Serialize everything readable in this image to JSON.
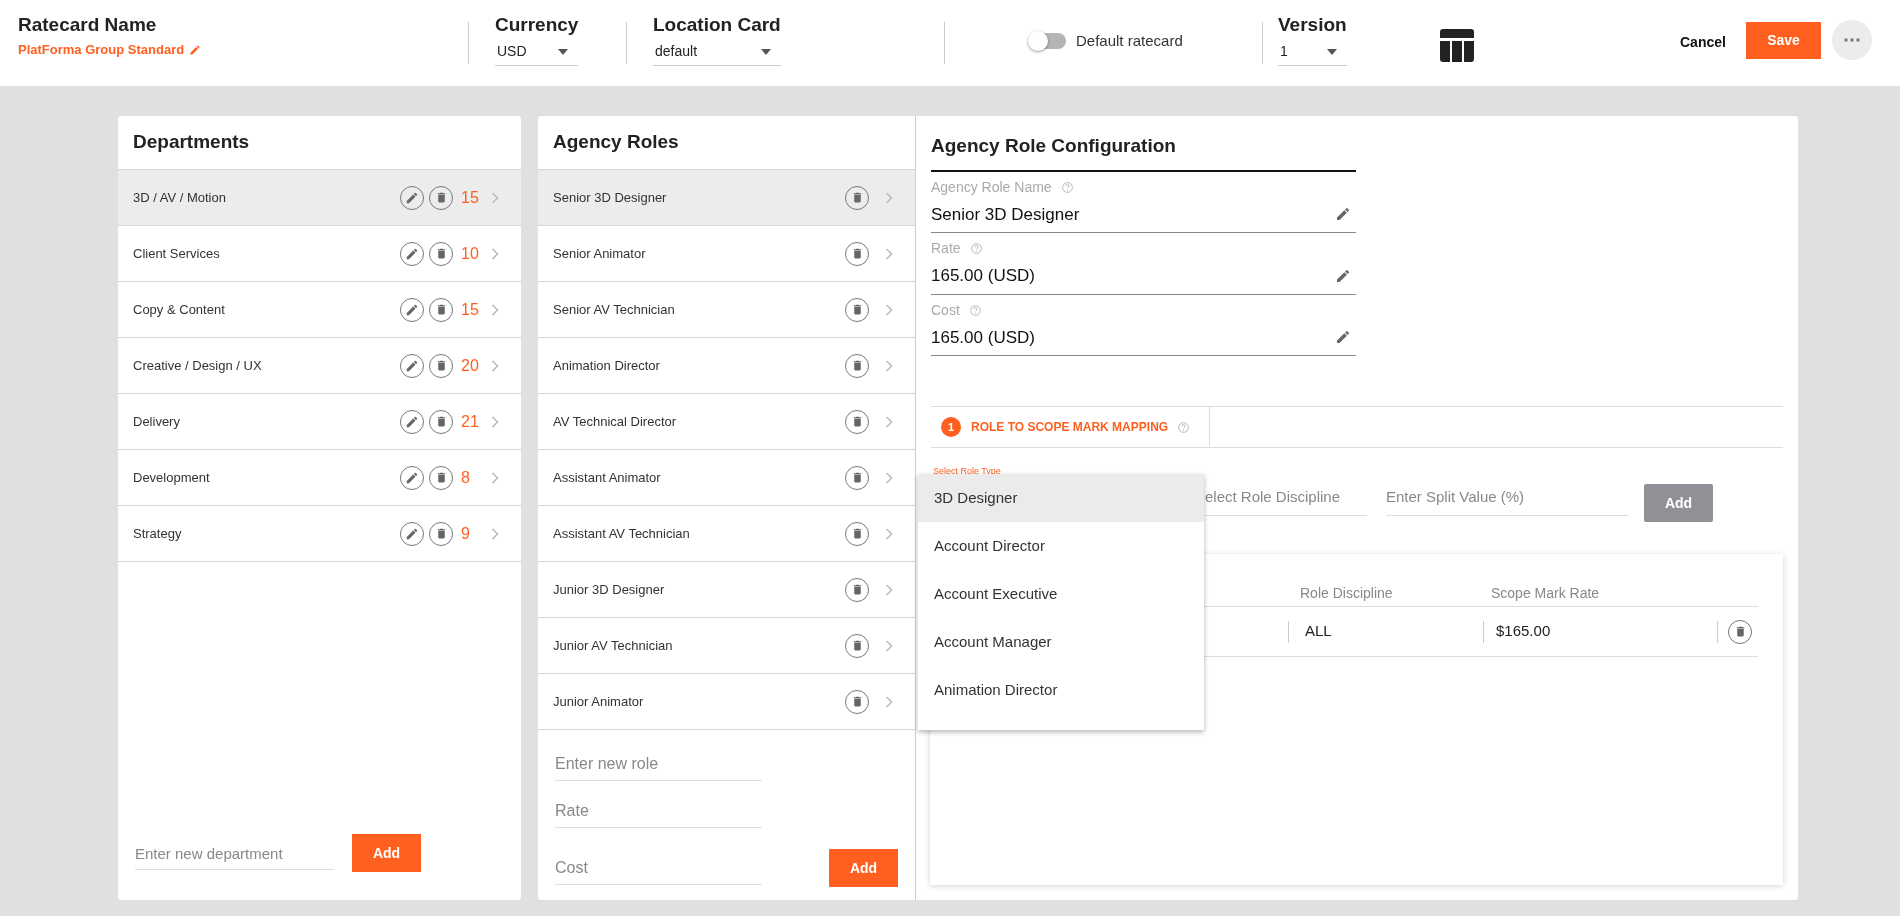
{
  "header": {
    "ratecard_name": {
      "label": "Ratecard Name",
      "value": "PlatForma Group Standard"
    },
    "currency": {
      "label": "Currency",
      "value": "USD"
    },
    "location_card": {
      "label": "Location Card",
      "value": "default"
    },
    "default_ratecard": {
      "label": "Default ratecard",
      "on": false
    },
    "version": {
      "label": "Version",
      "value": "1"
    },
    "cancel": "Cancel",
    "save": "Save"
  },
  "departments": {
    "title": "Departments",
    "items": [
      {
        "name": "3D / AV / Motion",
        "count": "15",
        "selected": true
      },
      {
        "name": "Client Services",
        "count": "10",
        "selected": false
      },
      {
        "name": "Copy & Content",
        "count": "15",
        "selected": false
      },
      {
        "name": "Creative / Design / UX",
        "count": "20",
        "selected": false
      },
      {
        "name": "Delivery",
        "count": "21",
        "selected": false
      },
      {
        "name": "Development",
        "count": "8",
        "selected": false
      },
      {
        "name": "Strategy",
        "count": "9",
        "selected": false
      }
    ],
    "new_placeholder": "Enter new department",
    "add": "Add"
  },
  "agency_roles": {
    "title": "Agency Roles",
    "items": [
      {
        "name": "Senior 3D Designer",
        "selected": true
      },
      {
        "name": "Senior Animator",
        "selected": false
      },
      {
        "name": "Senior AV Technician",
        "selected": false
      },
      {
        "name": "Animation Director",
        "selected": false
      },
      {
        "name": "AV Technical Director",
        "selected": false
      },
      {
        "name": "Assistant Animator",
        "selected": false
      },
      {
        "name": "Assistant AV Technician",
        "selected": false
      },
      {
        "name": "Junior 3D Designer",
        "selected": false
      },
      {
        "name": "Junior AV Technician",
        "selected": false
      },
      {
        "name": "Junior Animator",
        "selected": false
      }
    ],
    "new_role_placeholder": "Enter new role",
    "rate_placeholder": "Rate",
    "cost_placeholder": "Cost",
    "add": "Add"
  },
  "configuration": {
    "title": "Agency Role Configuration",
    "fields": [
      {
        "label": "Agency Role Name",
        "value": "Senior 3D Designer"
      },
      {
        "label": "Rate",
        "value": "165.00 (USD)"
      },
      {
        "label": "Cost",
        "value": "165.00 (USD)"
      }
    ],
    "step": {
      "number": "1",
      "label": "ROLE TO SCOPE MARK MAPPING"
    },
    "role_type": {
      "label": "Select Role Type",
      "options": [
        {
          "label": "3D Designer",
          "selected": true
        },
        {
          "label": "Account Director",
          "selected": false
        },
        {
          "label": "Account Executive",
          "selected": false
        },
        {
          "label": "Account Manager",
          "selected": false
        },
        {
          "label": "Animation Director",
          "selected": false
        }
      ]
    },
    "role_discipline": {
      "placeholder": "elect Role Discipline"
    },
    "split_value": {
      "placeholder": "Enter Split Value (%)"
    },
    "add": {
      "label": "Add",
      "disabled": true
    },
    "table": {
      "columns": [
        "Role Discipline",
        "Scope Mark Rate"
      ],
      "rows": [
        {
          "role_discipline": "ALL",
          "scope_mark_rate": "$165.00"
        }
      ]
    }
  }
}
